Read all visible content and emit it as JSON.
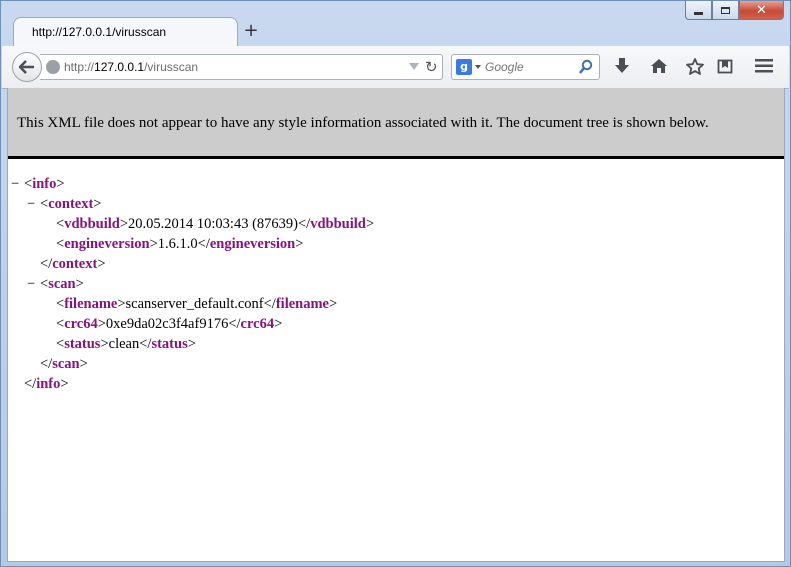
{
  "window": {
    "controls": {
      "minimize": "minimize",
      "maximize": "maximize",
      "close": "✕"
    }
  },
  "tab": {
    "title": "http://127.0.0.1/virusscan",
    "new_tab": "+"
  },
  "toolbar": {
    "url_prefix": "http://",
    "url_host": "127.0.0.1",
    "url_path": "/virusscan",
    "search_engine_icon": "g-icon",
    "search_engine_letter": "g",
    "search_placeholder": "Google"
  },
  "xml_viewer": {
    "info_message": "This XML file does not appear to have any style information associated with it. The document tree is shown below.",
    "collapse_symbol": "−",
    "tree": {
      "info_tag": "info",
      "context_tag": "context",
      "vdbbuild_tag": "vdbbuild",
      "vdbbuild_value": "20.05.2014 10:03:43 (87639)",
      "engineversion_tag": "engineversion",
      "engineversion_value": "1.6.1.0",
      "scan_tag": "scan",
      "filename_tag": "filename",
      "filename_value": "scanserver_default.conf",
      "crc64_tag": "crc64",
      "crc64_value": "0xe9da02c3f4af9176",
      "status_tag": "status",
      "status_value": "clean"
    }
  }
}
